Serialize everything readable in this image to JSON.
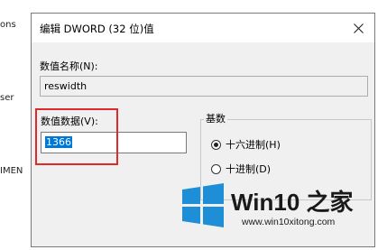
{
  "background_window": {
    "fragments": [
      "ons",
      "ser",
      "IMEN"
    ]
  },
  "dialog": {
    "title": "编辑 DWORD (32 位)值",
    "value_name_label": "数值名称(N):",
    "value_name": "reswidth",
    "value_data_label": "数值数据(V):",
    "value_data": "1366",
    "base_group_title": "基数",
    "base_options": [
      {
        "label": "十六进制(H)",
        "checked": true
      },
      {
        "label": "十进制(D)",
        "checked": false
      }
    ]
  },
  "watermark": {
    "brand": "Win10 之家",
    "url": "www.win10xitong.com"
  },
  "colors": {
    "highlight_box": "#e02a2a",
    "selection": "#0078d7",
    "windows_logo": "#1e8fd6"
  }
}
